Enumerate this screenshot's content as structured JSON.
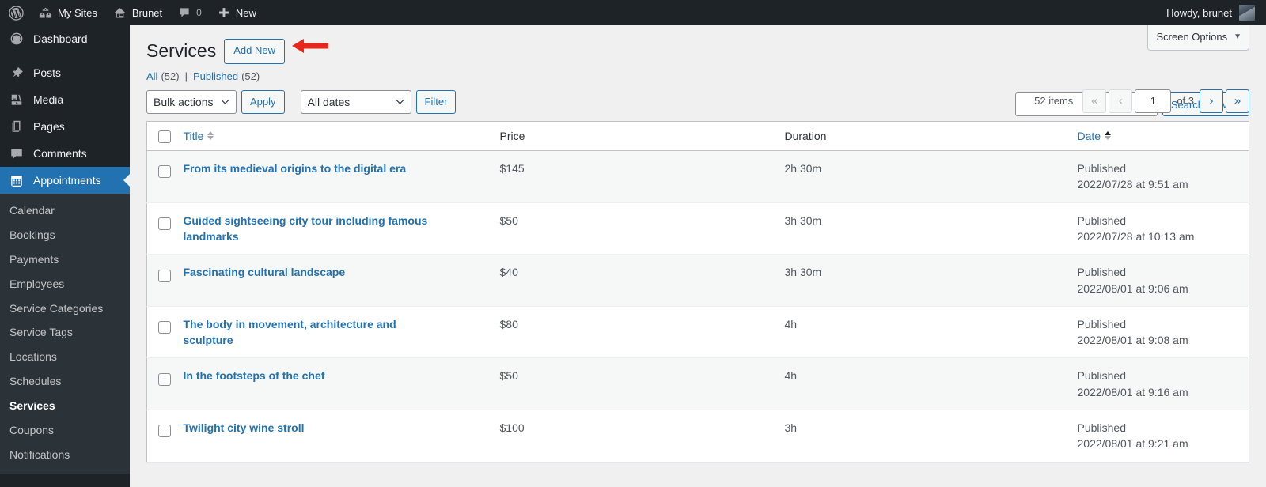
{
  "adminbar": {
    "logo": "wordpress-logo",
    "my_sites": "My Sites",
    "site_name": "Brunet",
    "comment_count": "0",
    "new": "New",
    "howdy": "Howdy, brunet"
  },
  "sidebar": {
    "items": [
      {
        "label": "Dashboard",
        "icon": "dashboard-icon",
        "active": false
      },
      {
        "label": "Posts",
        "icon": "pin-icon",
        "active": false
      },
      {
        "label": "Media",
        "icon": "media-icon",
        "active": false
      },
      {
        "label": "Pages",
        "icon": "pages-icon",
        "active": false
      },
      {
        "label": "Comments",
        "icon": "comment-icon",
        "active": false
      },
      {
        "label": "Appointments",
        "icon": "calendar-icon",
        "active": true
      }
    ],
    "submenu": [
      {
        "label": "Calendar",
        "current": false
      },
      {
        "label": "Bookings",
        "current": false
      },
      {
        "label": "Payments",
        "current": false
      },
      {
        "label": "Employees",
        "current": false
      },
      {
        "label": "Service Categories",
        "current": false
      },
      {
        "label": "Service Tags",
        "current": false
      },
      {
        "label": "Locations",
        "current": false
      },
      {
        "label": "Schedules",
        "current": false
      },
      {
        "label": "Services",
        "current": true
      },
      {
        "label": "Coupons",
        "current": false
      },
      {
        "label": "Notifications",
        "current": false
      }
    ]
  },
  "screen_options": {
    "label": "Screen Options"
  },
  "page": {
    "title": "Services",
    "add_new": "Add New",
    "annotation": "red-left-arrow pointing at Add New button"
  },
  "views": {
    "all_label": "All",
    "all_count": "(52)",
    "separator": "|",
    "published_label": "Published",
    "published_count": "(52)"
  },
  "search": {
    "value": "",
    "placeholder": "",
    "button": "Search Service"
  },
  "tablenav": {
    "bulk_actions": "Bulk actions",
    "apply": "Apply",
    "all_dates": "All dates",
    "filter": "Filter",
    "displaying_num": "52 items",
    "first_page": "«",
    "prev_page": "‹",
    "current_page": "1",
    "of_label": "of 3",
    "next_page": "›",
    "last_page": "»"
  },
  "table": {
    "columns": {
      "title": "Title",
      "price": "Price",
      "duration": "Duration",
      "date": "Date"
    },
    "rows": [
      {
        "title": "From its medieval origins to the digital era",
        "price": "$145",
        "duration": "2h 30m",
        "date_status": "Published",
        "date_stamp": "2022/07/28 at 9:51 am"
      },
      {
        "title": "Guided sightseeing city tour including famous landmarks",
        "price": "$50",
        "duration": "3h 30m",
        "date_status": "Published",
        "date_stamp": "2022/07/28 at 10:13 am"
      },
      {
        "title": "Fascinating cultural landscape",
        "price": "$40",
        "duration": "3h 30m",
        "date_status": "Published",
        "date_stamp": "2022/08/01 at 9:06 am"
      },
      {
        "title": "The body in movement, architecture and sculpture",
        "price": "$80",
        "duration": "4h",
        "date_status": "Published",
        "date_stamp": "2022/08/01 at 9:08 am"
      },
      {
        "title": "In the footsteps of the chef",
        "price": "$50",
        "duration": "4h",
        "date_status": "Published",
        "date_stamp": "2022/08/01 at 9:16 am"
      },
      {
        "title": "Twilight city wine stroll",
        "price": "$100",
        "duration": "3h",
        "date_status": "Published",
        "date_stamp": "2022/08/01 at 9:21 am"
      }
    ]
  },
  "colors": {
    "admin_dark": "#1d2327",
    "submenu_dark": "#2c3338",
    "accent_blue": "#2271b1",
    "page_bg": "#f0f0f1",
    "alt_row": "#f6f7f7",
    "annotation_red": "#e8261c"
  }
}
